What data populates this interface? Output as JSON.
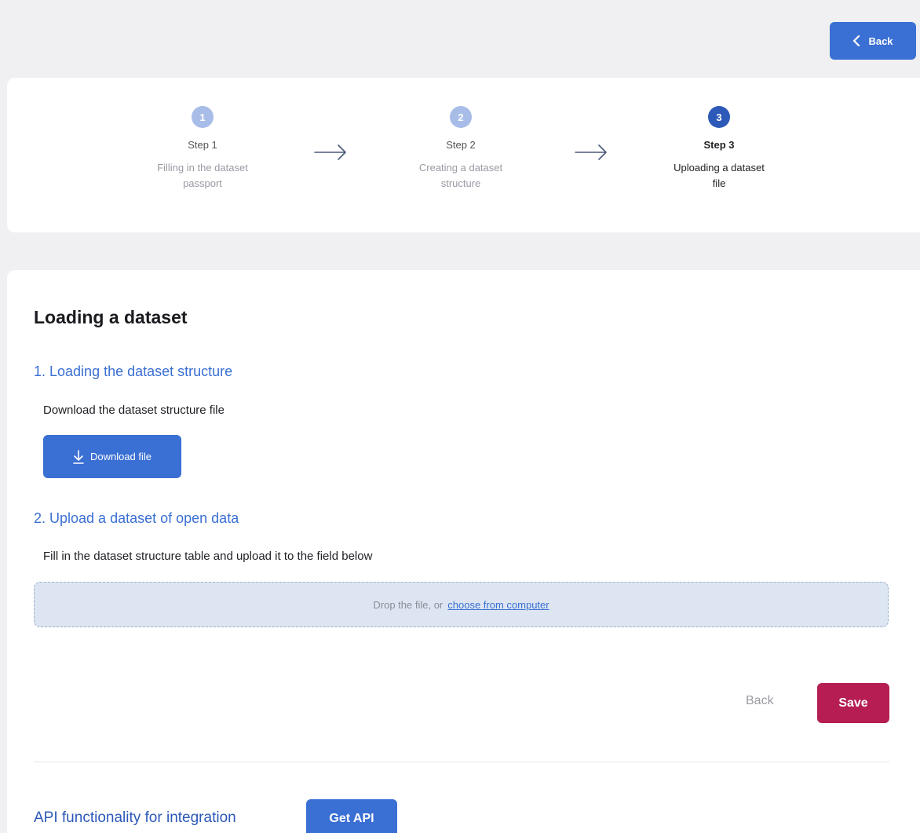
{
  "header": {
    "back_label": "Back"
  },
  "stepper": {
    "steps": [
      {
        "number": "1",
        "title": "Step 1",
        "desc_line1": "Filling in the dataset",
        "desc_line2": "passport"
      },
      {
        "number": "2",
        "title": "Step 2",
        "desc_line1": "Creating a dataset",
        "desc_line2": "structure"
      },
      {
        "number": "3",
        "title": "Step 3",
        "desc_line1": "Uploading a dataset",
        "desc_line2": "file"
      }
    ]
  },
  "main": {
    "title": "Loading a dataset",
    "section1": {
      "title": "1. Loading the dataset structure",
      "desc": "Download the dataset structure file",
      "download_label": "Download file"
    },
    "section2": {
      "title": "2. Upload a dataset of open data",
      "desc": "Fill in the dataset structure table and upload it to the field below",
      "drop_text": "Drop the file, or",
      "drop_link": "choose from computer"
    },
    "actions": {
      "back_label": "Back",
      "save_label": "Save"
    },
    "api": {
      "label": "API functionality for integration",
      "button_label": "Get API"
    }
  },
  "colors": {
    "accent": "#3a6fd3",
    "step_done": "#a7bde8",
    "step_active": "#2d59b8",
    "save": "#b51d53",
    "dropzone": "#dce5f1"
  }
}
